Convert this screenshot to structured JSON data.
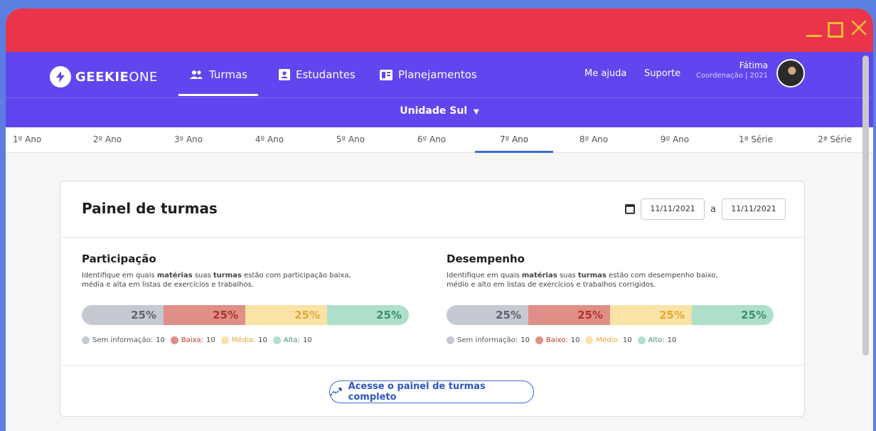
{
  "window": {
    "controls": {
      "minimize": "minimize-icon",
      "maximize": "maximize-icon",
      "close": "close-icon"
    },
    "colors": {
      "titlebar": "#e9344a",
      "controls": "#f7b93a"
    }
  },
  "header": {
    "logo": {
      "bold": "GEEKIE",
      "light": "ONE"
    },
    "nav": [
      {
        "label": "Turmas",
        "icon": "people-icon",
        "active": true
      },
      {
        "label": "Estudantes",
        "icon": "student-card-icon",
        "active": false
      },
      {
        "label": "Planejamentos",
        "icon": "planner-icon",
        "active": false
      }
    ],
    "links": {
      "help": "Me ajuda",
      "support": "Suporte"
    },
    "user": {
      "name": "Fátima",
      "role": "Coordenação | 2021"
    },
    "accent_color": "#6046ee"
  },
  "unit_selector": {
    "label": "Unidade Sul"
  },
  "grades": {
    "items": [
      "1º Ano",
      "2º Ano",
      "3º Ano",
      "4º Ano",
      "5º Ano",
      "6º Ano",
      "7º Ano",
      "8º Ano",
      "9º Ano",
      "1ª Série",
      "2ª Série"
    ],
    "active": "7º Ano"
  },
  "panel": {
    "title": "Painel de turmas",
    "date_from": "11/11/2021",
    "date_separator": "a",
    "date_to": "11/11/2021",
    "cta": "Acesse o painel de turmas completo"
  },
  "participation": {
    "title": "Participação",
    "description_parts": [
      "Identifique em quais ",
      "matérias",
      " suas ",
      "turmas",
      " estão com participação baixa, média e alta em listas de exercícios e trabalhos."
    ],
    "segments": [
      {
        "value": "25%",
        "bg": "#c5c9d1",
        "fg": "#5e6470"
      },
      {
        "value": "25%",
        "bg": "#df8f88",
        "fg": "#b2322b"
      },
      {
        "value": "25%",
        "bg": "#f9e3a6",
        "fg": "#e8a634"
      },
      {
        "value": "25%",
        "bg": "#aedfca",
        "fg": "#3d8f6e"
      }
    ],
    "legend": [
      {
        "label": "Sem informação:",
        "count": "10",
        "color": "#c5c9d1",
        "label_color": "#555"
      },
      {
        "label": "Baixa:",
        "count": "10",
        "color": "#df8f88",
        "label_color": "#c0392b"
      },
      {
        "label": "Média:",
        "count": "10",
        "color": "#f9e3a6",
        "label_color": "#e8a634"
      },
      {
        "label": "Alta:",
        "count": "10",
        "color": "#aedfca",
        "label_color": "#3d8f6e"
      }
    ]
  },
  "performance": {
    "title": "Desempenho",
    "description_parts": [
      "Identifique em quais ",
      "matérias",
      " suas ",
      "turmas",
      " estão com desempenho baixo, médio e alto em listas de exercícios e trabalhos corrigidos."
    ],
    "segments": [
      {
        "value": "25%",
        "bg": "#c5c9d1",
        "fg": "#5e6470"
      },
      {
        "value": "25%",
        "bg": "#df8f88",
        "fg": "#b2322b"
      },
      {
        "value": "25%",
        "bg": "#f9e3a6",
        "fg": "#e8a634"
      },
      {
        "value": "25%",
        "bg": "#aedfca",
        "fg": "#3d8f6e"
      }
    ],
    "legend": [
      {
        "label": "Sem informação:",
        "count": "10",
        "color": "#c5c9d1",
        "label_color": "#555"
      },
      {
        "label": "Baixo:",
        "count": "10",
        "color": "#df8f88",
        "label_color": "#c0392b"
      },
      {
        "label": "Médio:",
        "count": "10",
        "color": "#f9e3a6",
        "label_color": "#e8a634"
      },
      {
        "label": "Alto:",
        "count": "10",
        "color": "#aedfca",
        "label_color": "#3d8f6e"
      }
    ]
  }
}
